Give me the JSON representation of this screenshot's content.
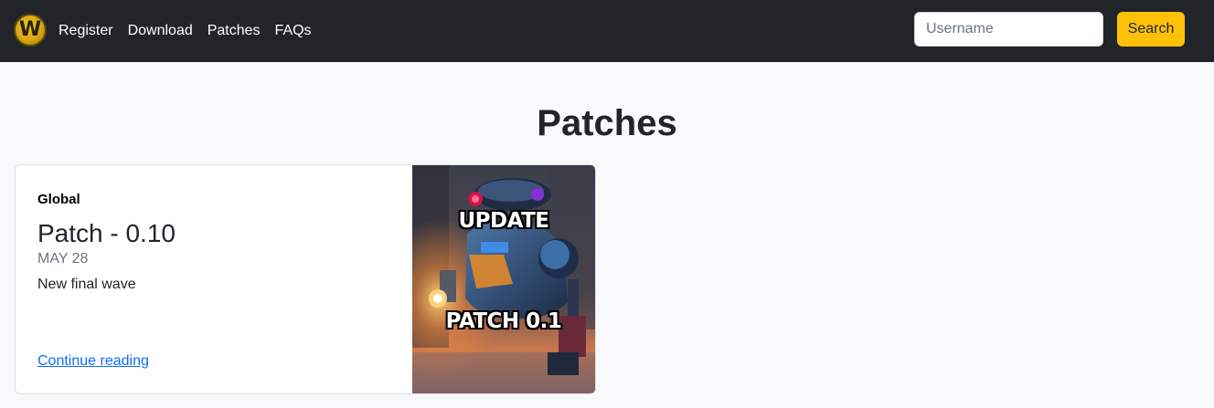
{
  "nav": {
    "logo_letter": "W",
    "links": [
      "Register",
      "Download",
      "Patches",
      "FAQs"
    ],
    "search_placeholder": "Username",
    "search_button": "Search"
  },
  "page": {
    "title": "Patches"
  },
  "card": {
    "category": "Global",
    "title": "Patch - 0.10",
    "date": "MAY 28",
    "summary": "New final wave",
    "link": "Continue reading",
    "image": {
      "top_text": "UPDATE",
      "bottom_text": "PATCH 0.1"
    }
  },
  "colors": {
    "navbar": "#212529",
    "accent": "#ffc107",
    "link": "#0d6efd",
    "background": "#f8f9fa"
  }
}
